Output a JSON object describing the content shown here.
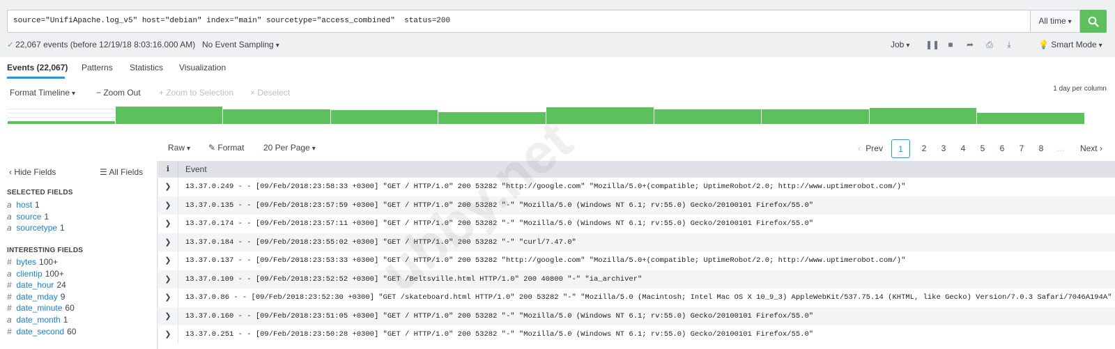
{
  "search": {
    "query": "source=\"UnifiApache.log_v5\" host=\"debian\" index=\"main\" sourcetype=\"access_combined\"  status=200",
    "time_range": "All time",
    "search_icon": "search-icon"
  },
  "status": {
    "events_text": "22,067 events (before 12/19/18 8:03:16.000 AM)",
    "sampling": "No Event Sampling",
    "job": "Job",
    "smart_mode": "Smart Mode"
  },
  "tabs": [
    {
      "label": "Events (22,067)",
      "active": true
    },
    {
      "label": "Patterns",
      "active": false
    },
    {
      "label": "Statistics",
      "active": false
    },
    {
      "label": "Visualization",
      "active": false
    }
  ],
  "timeline": {
    "format": "Format Timeline",
    "zoom_out": "Zoom Out",
    "zoom_selection": "Zoom to Selection",
    "deselect": "Deselect",
    "scale": "1 day per column",
    "bar_fill_color": "#5cc05c",
    "bar_levels": [
      0.15,
      1.0,
      0.82,
      0.78,
      0.68,
      0.97,
      0.82,
      0.85,
      0.92,
      0.64
    ]
  },
  "results_toolbar": {
    "raw": "Raw",
    "format": "Format",
    "per_page": "20 Per Page"
  },
  "pagination": {
    "prev": "Prev",
    "pages": [
      "1",
      "2",
      "3",
      "4",
      "5",
      "6",
      "7",
      "8"
    ],
    "ellipsis": "...",
    "next": "Next"
  },
  "sidebar": {
    "hide_fields": "Hide Fields",
    "all_fields": "All Fields",
    "selected_heading": "SELECTED FIELDS",
    "selected": [
      {
        "type": "a",
        "name": "host",
        "count": "1"
      },
      {
        "type": "a",
        "name": "source",
        "count": "1"
      },
      {
        "type": "a",
        "name": "sourcetype",
        "count": "1"
      }
    ],
    "interesting_heading": "INTERESTING FIELDS",
    "interesting": [
      {
        "type": "#",
        "name": "bytes",
        "count": "100+"
      },
      {
        "type": "a",
        "name": "clientip",
        "count": "100+"
      },
      {
        "type": "#",
        "name": "date_hour",
        "count": "24"
      },
      {
        "type": "#",
        "name": "date_mday",
        "count": "9"
      },
      {
        "type": "#",
        "name": "date_minute",
        "count": "60"
      },
      {
        "type": "a",
        "name": "date_month",
        "count": "1"
      },
      {
        "type": "#",
        "name": "date_second",
        "count": "60"
      }
    ]
  },
  "events_table": {
    "info_header": "i",
    "event_header": "Event",
    "rows": [
      "13.37.0.249 - - [09/Feb/2018:23:58:33 +0300] \"GET / HTTP/1.0\" 200 53282 \"http://google.com\" \"Mozilla/5.0+(compatible; UptimeRobot/2.0; http://www.uptimerobot.com/)\"",
      "13.37.0.135 - - [09/Feb/2018:23:57:59 +0300] \"GET / HTTP/1.0\" 200 53282 \"-\" \"Mozilla/5.0 (Windows NT 6.1; rv:55.0) Gecko/20100101 Firefox/55.0\"",
      "13.37.0.174 - - [09/Feb/2018:23:57:11 +0300] \"GET / HTTP/1.0\" 200 53282 \"-\" \"Mozilla/5.0 (Windows NT 6.1; rv:55.0) Gecko/20100101 Firefox/55.0\"",
      "13.37.0.184 - - [09/Feb/2018:23:55:02 +0300] \"GET / HTTP/1.0\" 200 53282 \"-\" \"curl/7.47.0\"",
      "13.37.0.137 - - [09/Feb/2018:23:53:33 +0300] \"GET / HTTP/1.0\" 200 53282 \"http://google.com\" \"Mozilla/5.0+(compatible; UptimeRobot/2.0; http://www.uptimerobot.com/)\"",
      "13.37.0.109 - - [09/Feb/2018:23:52:52 +0300] \"GET /Beltsville.html HTTP/1.0\" 200 40800 \"-\" \"ia_archiver\"",
      "13.37.0.86 - - [09/Feb/2018:23:52:30 +0300] \"GET /skateboard.html HTTP/1.0\" 200 53282 \"-\" \"Mozilla/5.0 (Macintosh; Intel Mac OS X 10_9_3) AppleWebKit/537.75.14 (KHTML, like Gecko) Version/7.0.3 Safari/7046A194A\"",
      "13.37.0.160 - - [09/Feb/2018:23:51:05 +0300] \"GET / HTTP/1.0\" 200 53282 \"-\" \"Mozilla/5.0 (Windows NT 6.1; rv:55.0) Gecko/20100101 Firefox/55.0\"",
      "13.37.0.251 - - [09/Feb/2018:23:50:28 +0300] \"GET / HTTP/1.0\" 200 53282 \"-\" \"Mozilla/5.0 (Windows NT 6.1; rv:55.0) Gecko/20100101 Firefox/55.0\""
    ]
  },
  "watermark": "ubby.net"
}
